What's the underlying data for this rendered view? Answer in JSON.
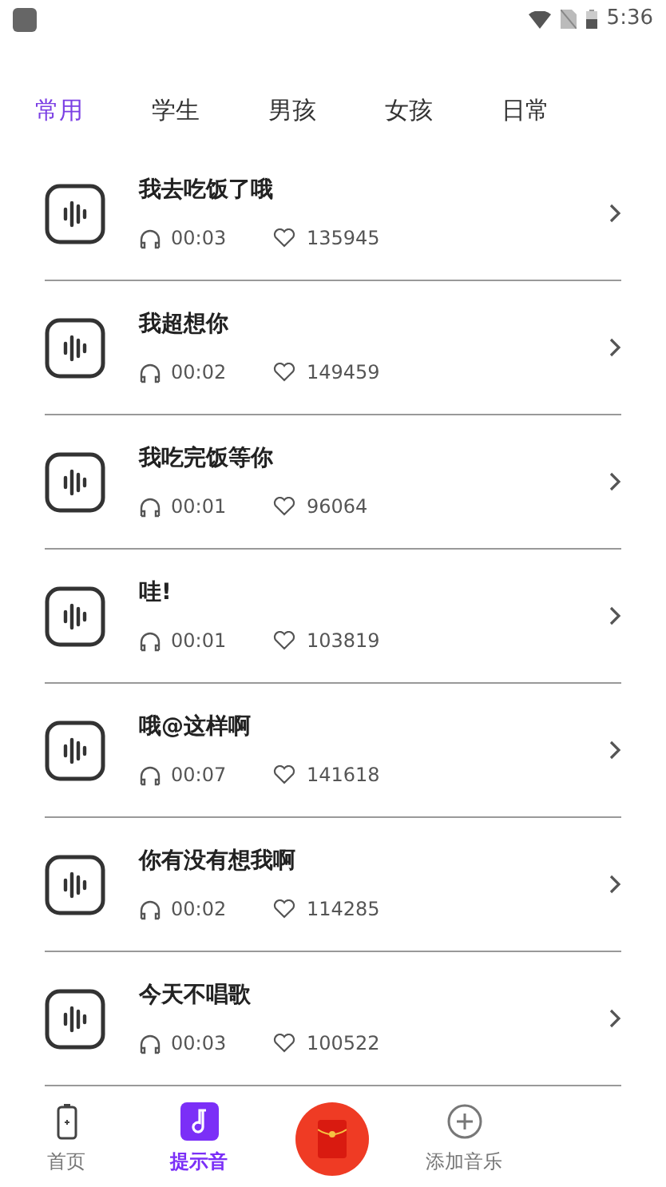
{
  "status_bar": {
    "time": "5:36"
  },
  "tabs": [
    {
      "label": "常用",
      "selected": true
    },
    {
      "label": "学生",
      "selected": false
    },
    {
      "label": "男孩",
      "selected": false
    },
    {
      "label": "女孩",
      "selected": false
    },
    {
      "label": "日常",
      "selected": false
    }
  ],
  "sounds": [
    {
      "title": "我去吃饭了哦",
      "duration": "00:03",
      "likes": "135945"
    },
    {
      "title": "我超想你",
      "duration": "00:02",
      "likes": "149459"
    },
    {
      "title": "我吃完饭等你",
      "duration": "00:01",
      "likes": "96064"
    },
    {
      "title": "哇!",
      "duration": "00:01",
      "likes": "103819"
    },
    {
      "title": "哦@这样啊",
      "duration": "00:07",
      "likes": "141618"
    },
    {
      "title": "你有没有想我啊",
      "duration": "00:02",
      "likes": "114285"
    },
    {
      "title": "今天不唱歌",
      "duration": "00:03",
      "likes": "100522"
    }
  ],
  "bottom_nav": [
    {
      "kind": "home",
      "label": "首页",
      "selected": false
    },
    {
      "kind": "ringtone",
      "label": "提示音",
      "selected": true
    },
    {
      "kind": "center"
    },
    {
      "kind": "add",
      "label": "添加音乐",
      "selected": false
    }
  ]
}
